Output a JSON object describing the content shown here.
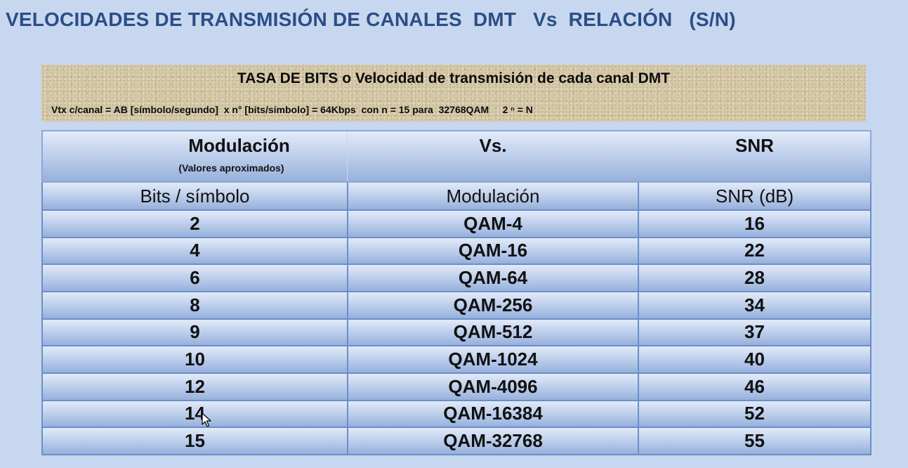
{
  "slide": {
    "title": "VELOCIDADES DE TRANSMISIÓN DE CANALES  DMT   Vs  RELACIÓN   (S/N)"
  },
  "info_box": {
    "title": "TASA DE BITS o Velocidad de transmisión de cada canal DMT",
    "formula": "Vtx c/canal = AB [símbolo/segundo]  x n° [bits/símbolo] = 64Kbps  con n = 15 para  32768QAM     2 ⁿ = N"
  },
  "table": {
    "header": {
      "modulation": "Modulación",
      "vs": "Vs.",
      "snr": "SNR",
      "note": "(Valores aproximados)"
    },
    "columns": [
      "Bits / símbolo",
      "Modulación",
      "SNR (dB)"
    ],
    "rows": [
      [
        "2",
        "QAM-4",
        "16"
      ],
      [
        "4",
        "QAM-16",
        "22"
      ],
      [
        "6",
        "QAM-64",
        "28"
      ],
      [
        "8",
        "QAM-256",
        "34"
      ],
      [
        "9",
        "QAM-512",
        "37"
      ],
      [
        "10",
        "QAM-1024",
        "40"
      ],
      [
        "12",
        "QAM-4096",
        "46"
      ],
      [
        "14",
        "QAM-16384",
        "52"
      ],
      [
        "15",
        "QAM-32768",
        "55"
      ]
    ]
  },
  "cursor_icon": "mouse-pointer-icon"
}
